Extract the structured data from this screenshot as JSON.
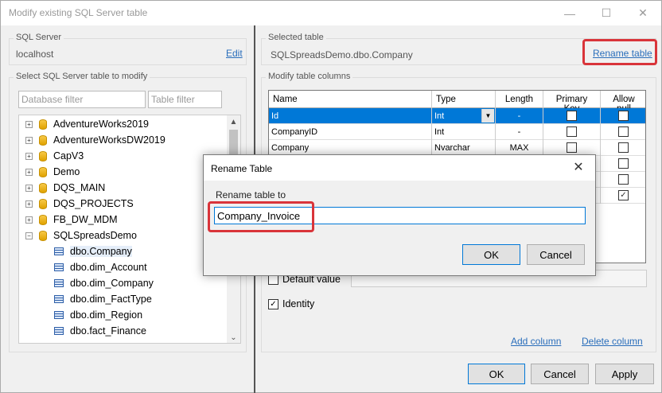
{
  "window": {
    "title": "Modify existing SQL Server table",
    "minimize_glyph": "—",
    "maximize_glyph": "☐",
    "close_glyph": "✕"
  },
  "sql_server": {
    "group_label": "SQL Server",
    "server_name": "localhost",
    "edit_link": "Edit"
  },
  "table_picker": {
    "group_label": "Select SQL Server table to modify",
    "database_filter_placeholder": "Database filter",
    "table_filter_placeholder": "Table filter",
    "items": [
      {
        "label": "AdventureWorks2019",
        "kind": "database",
        "expander": "+"
      },
      {
        "label": "AdventureWorksDW2019",
        "kind": "database",
        "expander": "+"
      },
      {
        "label": "CapV3",
        "kind": "database",
        "expander": "+"
      },
      {
        "label": "Demo",
        "kind": "database",
        "expander": "+"
      },
      {
        "label": "DQS_MAIN",
        "kind": "database",
        "expander": "+"
      },
      {
        "label": "DQS_PROJECTS",
        "kind": "database",
        "expander": "+"
      },
      {
        "label": "FB_DW_MDM",
        "kind": "database",
        "expander": "+"
      },
      {
        "label": "SQLSpreadsDemo",
        "kind": "database",
        "expander": "−"
      },
      {
        "label": "dbo.Company",
        "kind": "table",
        "selected": true
      },
      {
        "label": "dbo.dim_Account",
        "kind": "table"
      },
      {
        "label": "dbo.dim_Company",
        "kind": "table"
      },
      {
        "label": "dbo.dim_FactType",
        "kind": "table"
      },
      {
        "label": "dbo.dim_Region",
        "kind": "table"
      },
      {
        "label": "dbo.fact_Finance",
        "kind": "table"
      }
    ],
    "scroll_up": "▲",
    "scroll_down": "⌄"
  },
  "selected_table": {
    "group_label": "Selected table",
    "name": "SQLSpreadsDemo.dbo.Company",
    "rename_link": "Rename table"
  },
  "columns": {
    "group_label": "Modify table columns",
    "headers": {
      "name": "Name",
      "type": "Type",
      "length": "Length",
      "primary_key": "Primary Key",
      "allow_null": "Allow null"
    },
    "rows": [
      {
        "name": "Id",
        "type": "Int",
        "length": "-",
        "primary_key": false,
        "allow_null": false,
        "selected": true
      },
      {
        "name": "CompanyID",
        "type": "Int",
        "length": "-",
        "primary_key": false,
        "allow_null": false
      },
      {
        "name": "Company",
        "type": "Nvarchar",
        "length": "MAX",
        "primary_key": false,
        "allow_null": false
      },
      {
        "name": "",
        "type": "",
        "length": "",
        "primary_key": null,
        "allow_null": false
      },
      {
        "name": "",
        "type": "",
        "length": "",
        "primary_key": null,
        "allow_null": false
      },
      {
        "name": "",
        "type": "",
        "length": "",
        "primary_key": null,
        "allow_null": true
      }
    ],
    "dropdown_glyph": "▼",
    "check_glyph": "✓"
  },
  "options": {
    "default_value_label": "Default value",
    "identity_label": "Identity",
    "identity_checked": true,
    "add_column_link": "Add column",
    "delete_column_link": "Delete column"
  },
  "footer": {
    "ok_label": "OK",
    "cancel_label": "Cancel",
    "apply_label": "Apply"
  },
  "rename_dialog": {
    "title": "Rename Table",
    "close_glyph": "✕",
    "prompt_label": "Rename table to",
    "input_value": "Company_Invoice",
    "ok_label": "OK",
    "cancel_label": "Cancel"
  },
  "colors": {
    "highlight_red": "#d9343a",
    "selection_blue": "#0078d7",
    "link_blue": "#2a6ebb"
  }
}
